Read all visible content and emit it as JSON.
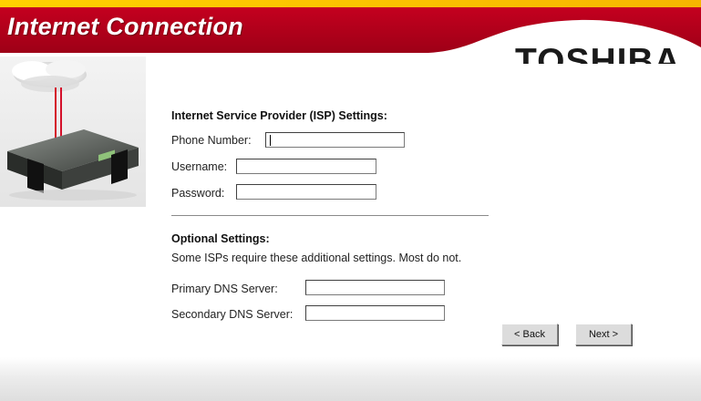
{
  "header": {
    "title": "Internet Connection",
    "brand": "TOSHIBA"
  },
  "isp": {
    "heading": "Internet Service Provider (ISP) Settings:",
    "phone_label": "Phone Number:",
    "phone_value": "",
    "username_label": "Username:",
    "username_value": "",
    "password_label": "Password:",
    "password_value": ""
  },
  "optional": {
    "heading": "Optional Settings:",
    "note": "Some ISPs require these additional settings. Most do not.",
    "primary_dns_label": "Primary DNS Server:",
    "primary_dns_value": "",
    "secondary_dns_label": "Secondary DNS Server:",
    "secondary_dns_value": ""
  },
  "nav": {
    "back_label": "< Back",
    "next_label": "Next >"
  },
  "colors": {
    "banner_red": "#b5001c",
    "banner_yellow": "#f2c200",
    "text": "#1a1a1a"
  }
}
